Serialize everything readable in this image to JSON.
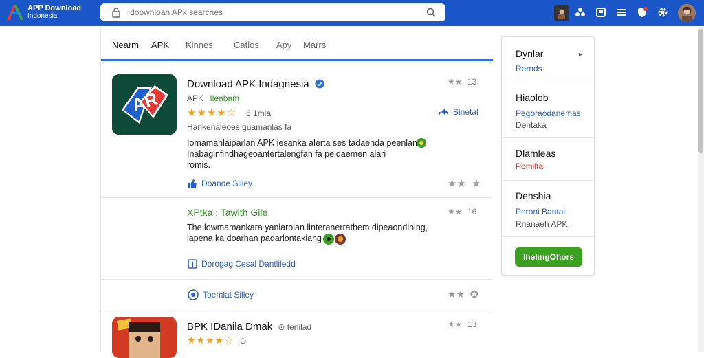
{
  "header": {
    "logo_title": "APP Download",
    "logo_sub": "Indonesia",
    "search_placeholder": "|doownloan APk searches"
  },
  "tabs": [
    "Nearm",
    "APK",
    "Kinnes",
    "Catlos",
    "Apy",
    "Marrs"
  ],
  "items": [
    {
      "title": "Download APK Indagnesia",
      "publisher": "APK",
      "category": "Ileabam",
      "stars": "★★★★☆",
      "rating_count": "6 1mia",
      "tags": "Hankenaleoes guamanlas fa",
      "desc_line1": "Iomamanlaiparlan APK iesanka alerta ses tadaenda peenlan",
      "desc_line2": "Inabaginfindhageoantertalengfan fa peidaemen alari",
      "desc_line3": "romis.",
      "action": "Doande Silley",
      "share": "Sinetal",
      "rating_right": "13"
    },
    {
      "title": "XPtka : Tawith Gile",
      "desc_line1": "The lowmamankara yanlarolan linteranerrathem dipeaondining,",
      "desc_line2": "lapena ka doarhan padarlontakiang",
      "action": "Dorogag Cesal Dantliledd",
      "rating_right": "16"
    },
    {
      "action": "Toemlat Silley"
    },
    {
      "title": "BPK IDanila Dmak",
      "subtitle": "tenilad",
      "stars": "★★★★☆",
      "rating_right": "13"
    }
  ],
  "side_panel": {
    "sections": [
      {
        "heading": "Dynlar",
        "link": "Rernds"
      },
      {
        "heading": "Hiaolob",
        "link": "Pegoraodanemas",
        "note": "Dentaka"
      },
      {
        "heading": "Dlamleas",
        "link": "Pomiltal"
      },
      {
        "heading": "Denshia",
        "link": "Peroni Bantal.",
        "note": "Rnanaeh APK"
      }
    ],
    "button": "IhelingOhors"
  }
}
